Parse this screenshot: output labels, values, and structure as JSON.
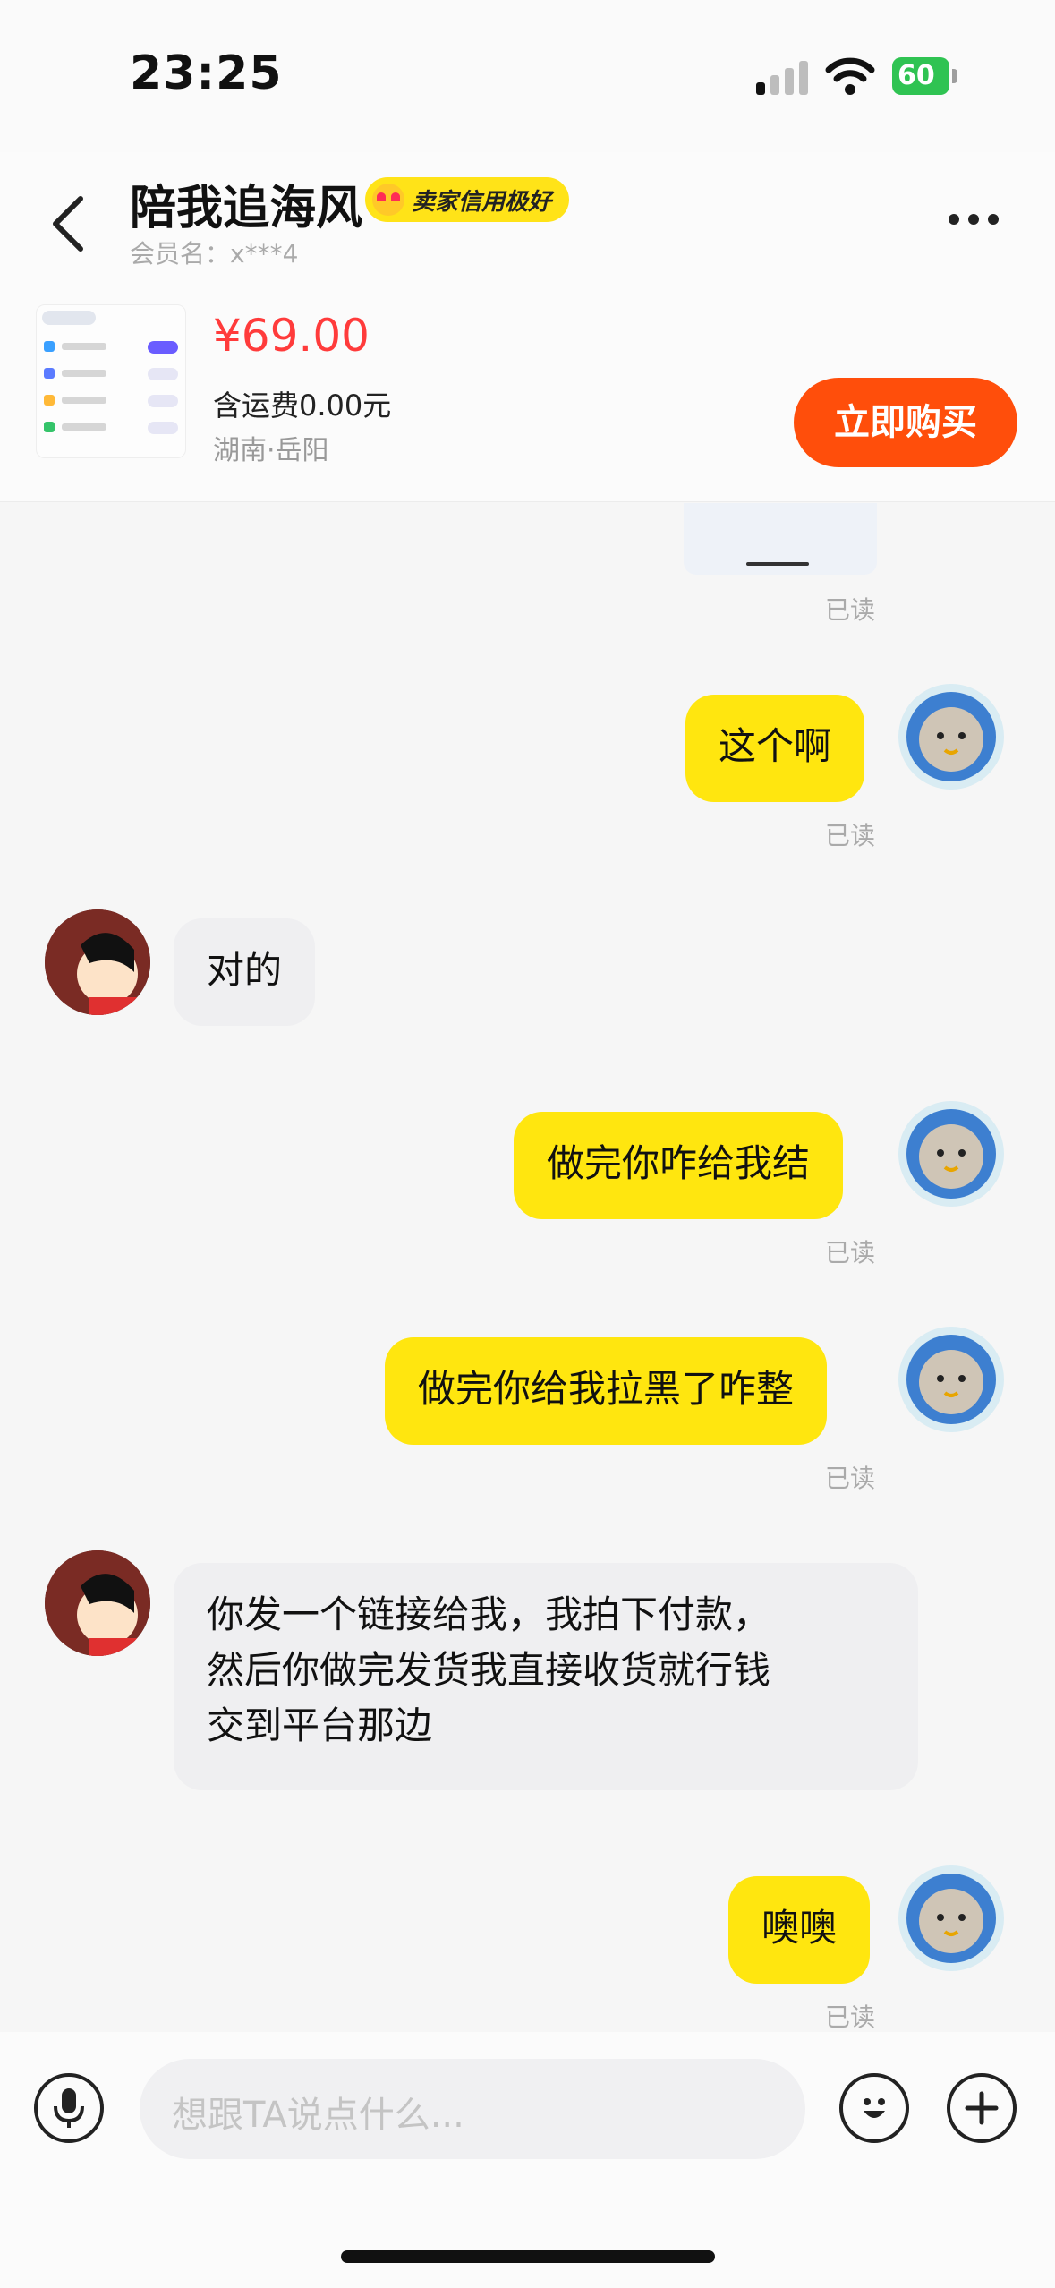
{
  "status_bar": {
    "time": "23:25",
    "battery": "60"
  },
  "header": {
    "title": "陪我追海风",
    "badge": "卖家信用极好",
    "member_label": "会员名：",
    "member_name": "x***4"
  },
  "product": {
    "price": "¥69.00",
    "shipping": "含运费0.00元",
    "location": "湖南·岳阳",
    "buy_button": "立即购买"
  },
  "messages": [
    {
      "sender": "me",
      "text": "已读",
      "kind": "image-read"
    },
    {
      "sender": "me",
      "text": "这个啊",
      "status": "已读"
    },
    {
      "sender": "peer",
      "text": "对的"
    },
    {
      "sender": "me",
      "text": "做完你咋给我结",
      "status": "已读"
    },
    {
      "sender": "me",
      "text": "做完你给我拉黑了咋整",
      "status": "已读"
    },
    {
      "sender": "peer",
      "lines": [
        "你发一个链接给我，我拍下付款，",
        "然后你做完发货我直接收货就行钱",
        "交到平台那边"
      ]
    },
    {
      "sender": "me",
      "text": "噢噢",
      "status": "已读"
    }
  ],
  "input": {
    "placeholder": "想跟TA说点什么..."
  },
  "icons": {
    "back": "chevron-left-icon",
    "more": "more-dots-icon",
    "voice": "microphone-icon",
    "emoji": "smiley-icon",
    "add": "plus-icon"
  },
  "colors": {
    "my_bubble": "#ffe60f",
    "peer_bubble": "#efeff1",
    "buy_button": "#ff4e0b",
    "price": "#ff3b3b"
  }
}
